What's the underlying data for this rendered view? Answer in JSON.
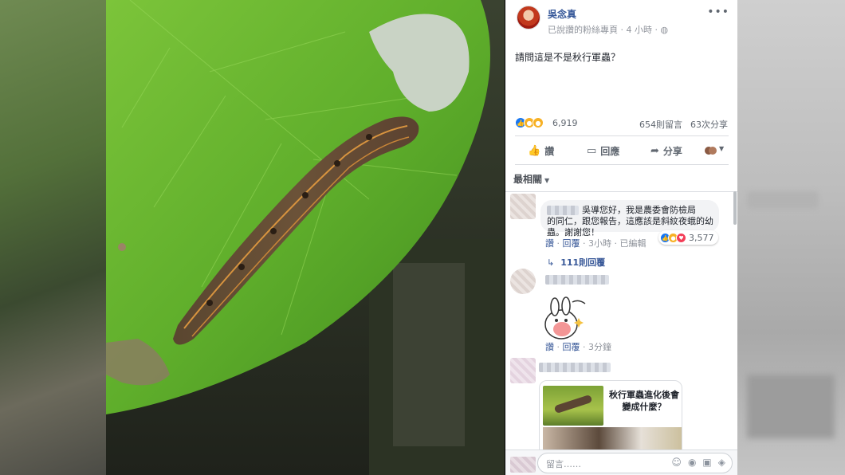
{
  "post": {
    "author": "吳念真",
    "meta": "已說讚的粉絲專頁 · 4 小時 · ",
    "more_icon": "more-horizontal-icon",
    "text": "請問這是不是秋行軍蟲？"
  },
  "stats": {
    "reaction_count": "6,919",
    "comments": "654則留言",
    "shares": "63次分享",
    "reaction_types": [
      "like",
      "wow",
      "haha"
    ]
  },
  "actions": {
    "like": "讚",
    "comment": "回應",
    "share": "分享"
  },
  "sort": {
    "label": "最相關"
  },
  "comments": [
    {
      "text_line1": "吳導您好，我是農委會防檢局",
      "text_line2": "的同仁，跟您報告，這應該是斜紋夜蛾的幼蟲。謝謝您！",
      "reaction_count": "3,577",
      "reaction_types": [
        "like",
        "wow",
        "love"
      ],
      "like": "讚",
      "reply": "回覆",
      "time": "3小時",
      "edited": "已編輯",
      "replies": "111則回覆"
    },
    {
      "sticker": "good-bunny-sticker",
      "like": "讚",
      "reply": "回覆",
      "time": "3分鐘"
    },
    {
      "card_title": "秋行軍蟲進化後會變成什麼？"
    }
  ],
  "composer": {
    "placeholder": "留言……"
  },
  "colors": {
    "link_blue": "#365899",
    "like_blue": "#1877f2",
    "love_red": "#f33e58",
    "haha_yellow": "#f7b125"
  }
}
